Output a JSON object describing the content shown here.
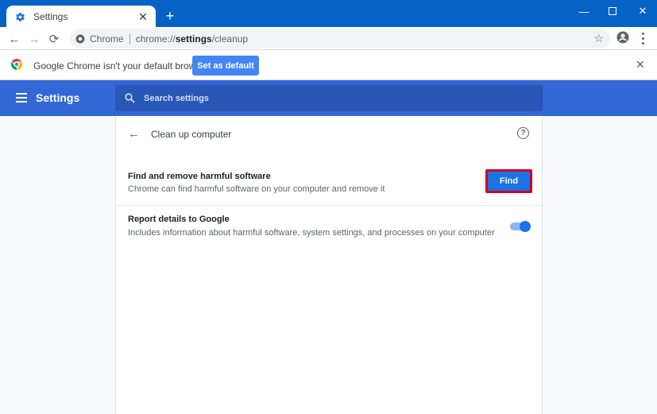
{
  "window": {
    "tab_title": "Settings",
    "new_tab_icon": "plus-icon",
    "controls": [
      "minimize",
      "maximize",
      "close"
    ]
  },
  "toolbar": {
    "site_chip": "Chrome",
    "url_prefix": "chrome://",
    "url_host": "settings",
    "url_path": "/cleanup"
  },
  "infobar": {
    "message": "Google Chrome isn't your default browser",
    "button_label": "Set as default"
  },
  "settings_header": {
    "title": "Settings",
    "search_placeholder": "Search settings"
  },
  "page": {
    "title": "Clean up computer",
    "rows": [
      {
        "label": "Find and remove harmful software",
        "sub": "Chrome can find harmful software on your computer and remove it",
        "button_label": "Find"
      },
      {
        "label": "Report details to Google",
        "sub": "Includes information about harmful software, system settings, and processes on your computer",
        "toggle_on": true
      }
    ]
  },
  "colors": {
    "titlebar": "#0463c4",
    "settings_header": "#3367d6",
    "accent": "#1a73e8",
    "highlight_border": "#d0021b"
  }
}
